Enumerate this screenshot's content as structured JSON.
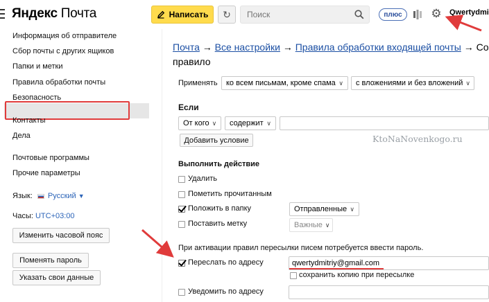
{
  "header": {
    "logo_ya": "Яндекс",
    "logo_mail": "Почта",
    "write_label": "Написать",
    "search_placeholder": "Поиск",
    "plus_label": "плюс",
    "username": "Qwertydmi"
  },
  "sidebar": {
    "items": [
      "Информация об отправителе",
      "Сбор почты с других ящиков",
      "Папки и метки",
      "Правила обработки почты",
      "Безопасность",
      "Контакты",
      "Дела",
      "Почтовые программы",
      "Прочие параметры"
    ],
    "language_label": "Язык:",
    "language_value": "Русский",
    "clock_label": "Часы:",
    "clock_value": "UTC+03:00",
    "change_timezone_button": "Изменить часовой пояс",
    "change_password_button": "Поменять пароль",
    "personal_data_button": "Указать свои данные"
  },
  "main": {
    "breadcrumb": {
      "mail": "Почта",
      "all_settings": "Все настройки",
      "rules": "Правила обработки входящей почты",
      "current_line1": "Созд",
      "current_line2": "правило",
      "separator": "→"
    },
    "apply_label": "Применять",
    "apply_select": "ко всем письмам, кроме спама",
    "attachments_select": "с вложениями и без вложений",
    "if_heading": "Если",
    "condition_field_select": "От кого",
    "condition_op_select": "содержит",
    "condition_value": "",
    "add_condition_button": "Добавить условие",
    "action_heading": "Выполнить действие",
    "actions": [
      {
        "label": "Удалить",
        "checked": false
      },
      {
        "label": "Пометить прочитанным",
        "checked": false
      },
      {
        "label": "Положить в папку",
        "checked": true
      },
      {
        "label": "Поставить метку",
        "checked": false
      }
    ],
    "folder_select": "Отправленные",
    "label_select": "Важные",
    "password_notice": "При активации правил пересылки писем потребуется ввести пароль.",
    "forward_label": "Переслать по адресу",
    "forward_checked": true,
    "forward_email": "qwertydmitriy@gmail.com",
    "save_copy_label": "сохранить копию при пересылке",
    "save_copy_checked": false,
    "notify_label": "Уведомить по адресу",
    "notify_checked": false
  },
  "watermark": "KtoNaNovenkogo.ru",
  "colors": {
    "accent_yellow": "#ffdb4d",
    "link_blue": "#1a4ea3",
    "annotation_red": "#e03b3b"
  }
}
